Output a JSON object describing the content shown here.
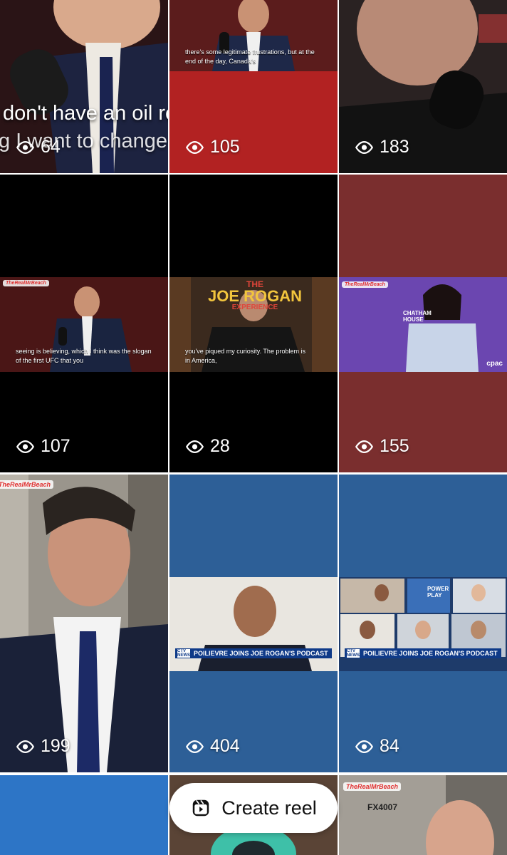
{
  "tiles": [
    {
      "views": "64",
      "subtitle_line1": "don't have an oil re",
      "subtitle_line2": "g I want to change"
    },
    {
      "views": "105",
      "caption": "there's some legitimate frustrations, but at the end of the day, Canada's"
    },
    {
      "views": "183"
    },
    {
      "views": "107",
      "caption": "seeing is believing, which I think was the slogan of the first UFC that you"
    },
    {
      "views": "28",
      "caption": "you've piqued my curiosity. The problem is in America,",
      "sign_line1": "THE",
      "sign_line2": "JOE ROGAN",
      "sign_line3": "EXPERIENCE"
    },
    {
      "views": "155",
      "sign_text": "CHATHAM HOUSE",
      "channel": "cpac"
    },
    {
      "views": "199"
    },
    {
      "views": "404",
      "banner": "POILIEVRE JOINS JOE ROGAN'S PODCAST",
      "network": "CTV NEWS"
    },
    {
      "views": "84",
      "banner": "POILIEVRE JOINS JOE ROGAN'S PODCAST",
      "network": "CTV NEWS",
      "show": "POWER PLAY"
    },
    {
      "views": ""
    },
    {
      "views": ""
    },
    {
      "views": "",
      "plate": "FX4007"
    }
  ],
  "create_reel": {
    "label": "Create reel"
  },
  "watermark_text": "TheRealMrBeach",
  "colors": {
    "red": "#b22222",
    "maroon": "#7a2e2e",
    "blue": "#2d5f97",
    "black": "#000000"
  }
}
